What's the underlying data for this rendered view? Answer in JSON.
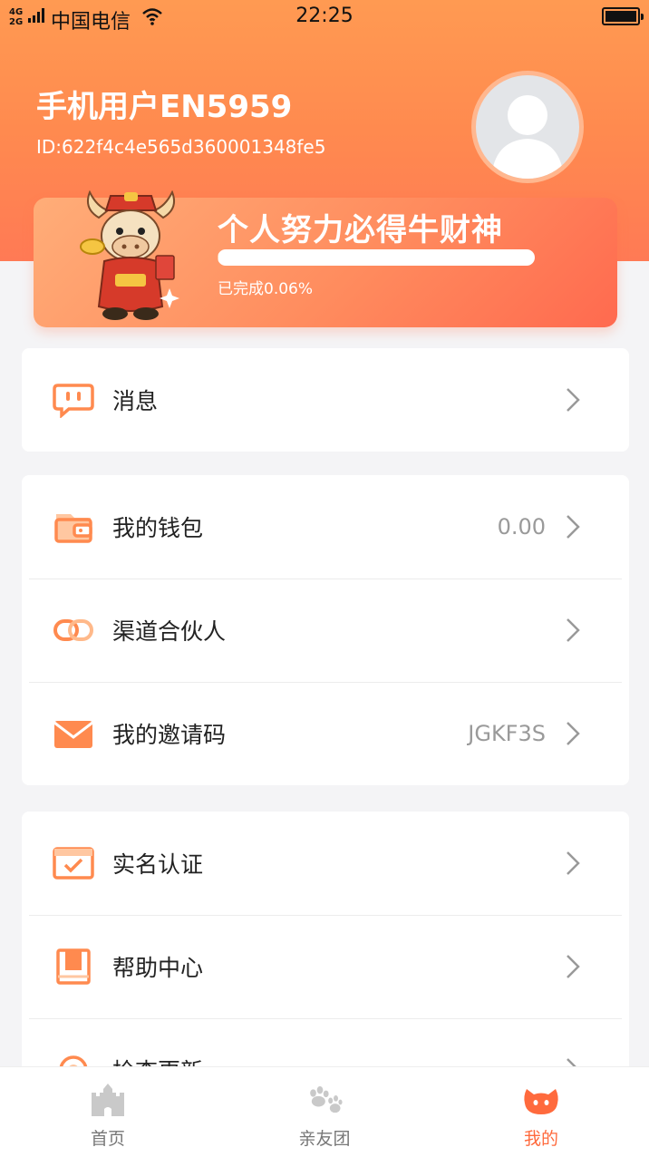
{
  "status_bar": {
    "network_top": "4G",
    "network_bottom": "2G",
    "carrier": "中国电信",
    "time": "22:25",
    "icons": [
      "signal-icon",
      "wifi-icon",
      "battery-icon"
    ]
  },
  "profile": {
    "name": "手机用户EN5959",
    "id": "ID:622f4c4e565d360001348fe5"
  },
  "promo": {
    "title": "个人努力必得牛财神",
    "progress_text": "已完成0.06%",
    "progress_fraction": 0.0006
  },
  "menu_groups": [
    {
      "items": [
        {
          "label": "消息",
          "value": "",
          "icon": "message-icon"
        }
      ]
    },
    {
      "items": [
        {
          "label": "我的钱包",
          "value": "0.00",
          "icon": "wallet-icon"
        },
        {
          "label": "渠道合伙人",
          "value": "",
          "icon": "link-icon"
        },
        {
          "label": "我的邀请码",
          "value": "JGKF3S",
          "icon": "envelope-icon"
        }
      ]
    },
    {
      "items": [
        {
          "label": "实名认证",
          "value": "",
          "icon": "verify-icon"
        },
        {
          "label": "帮助中心",
          "value": "",
          "icon": "book-icon"
        },
        {
          "label": "检查更新",
          "value": "",
          "icon": "update-icon"
        }
      ]
    }
  ],
  "tabbar": {
    "tabs": [
      {
        "label": "首页",
        "icon": "castle-icon",
        "active": false
      },
      {
        "label": "亲友团",
        "icon": "paw-icon",
        "active": false
      },
      {
        "label": "我的",
        "icon": "cat-face-icon",
        "active": true
      }
    ]
  },
  "colors": {
    "accent": "#ff8a4f",
    "accent_dark": "#ff6a3d",
    "icon_orange": "#ff8a4f",
    "background": "#f4f4f6"
  }
}
